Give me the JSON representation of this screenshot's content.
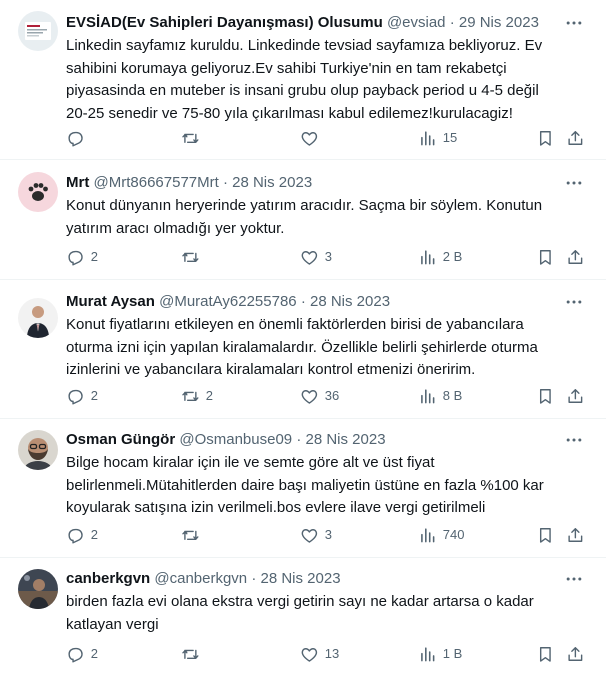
{
  "tweets": [
    {
      "name": "EVSİAD(Ev Sahipleri Dayanışması) Olusumu",
      "handle": "@evsiad",
      "dot": "·",
      "date": "29 Nis 2023",
      "text": "Linkedin sayfamız kuruldu. Linkedinde tevsiad sayfamıza bekliyoruz. Ev\nsahibini korumaya geliyoruz.Ev sahibi Turkiye'nin en tam rekabetçi\npiyasasinda en muteber is insani grubu olup payback period u 4-5 değil\n20-25 senedir ve 75-80 yıla çıkarılması kabul edilemez!kurulacagiz!",
      "replies": "",
      "retweets": "",
      "likes": "",
      "views": "15",
      "avatar_icon": "evsiad-logo-avatar"
    },
    {
      "name": "Mrt",
      "handle": "@Mrt86667577Mrt",
      "dot": "·",
      "date": "28 Nis 2023",
      "text": "Konut dünyanın heryerinde yatırım aracıdır. Saçma bir söylem. Konutun\nyatırım aracı olmadığı yer yoktur.",
      "replies": "2",
      "retweets": "",
      "likes": "3",
      "views": "2 B",
      "avatar_icon": "paw-avatar"
    },
    {
      "name": "Murat Aysan",
      "handle": "@MuratAy62255786",
      "dot": "·",
      "date": "28 Nis 2023",
      "text": "Konut fiyatlarını etkileyen en önemli faktörlerden birisi de yabancılara\noturma izni için yapılan kiralamalardır. Özellikle belirli şehirlerde oturma\nizinlerini ve yabancılara kiralamaları kontrol etmenizi öneririm.",
      "replies": "2",
      "retweets": "2",
      "likes": "36",
      "views": "8 B",
      "avatar_icon": "suit-person-avatar"
    },
    {
      "name": "Osman Güngör",
      "handle": "@Osmanbuse09",
      "dot": "·",
      "date": "28 Nis 2023",
      "text": "Bilge hocam kiralar için ile ve semte göre alt ve üst fiyat\nbelirlenmeli.Mütahitlerden daire başı maliyetin üstüne en fazla %100 kar\nkoyularak satışına izin verilmeli.bos evlere ilave vergi getirilmeli",
      "replies": "2",
      "retweets": "",
      "likes": "3",
      "views": "740",
      "avatar_icon": "bearded-man-avatar"
    },
    {
      "name": "canberkgvn",
      "handle": "@canberkgvn",
      "dot": "·",
      "date": "28 Nis 2023",
      "text": "birden fazla evi olana ekstra vergi getirin sayı ne kadar artarsa o kadar\nkatlayan vergi",
      "replies": "2",
      "retweets": "",
      "likes": "13",
      "views": "1 B",
      "avatar_icon": "photo-avatar"
    }
  ],
  "icons": {
    "more": "more-icon",
    "reply": "reply-icon",
    "retweet": "retweet-icon",
    "like": "heart-icon",
    "views": "views-icon",
    "bookmark": "bookmark-icon",
    "share": "share-icon"
  },
  "colors": {
    "text": "#0f1419",
    "secondary": "#536471",
    "divider": "#eff3f4"
  }
}
